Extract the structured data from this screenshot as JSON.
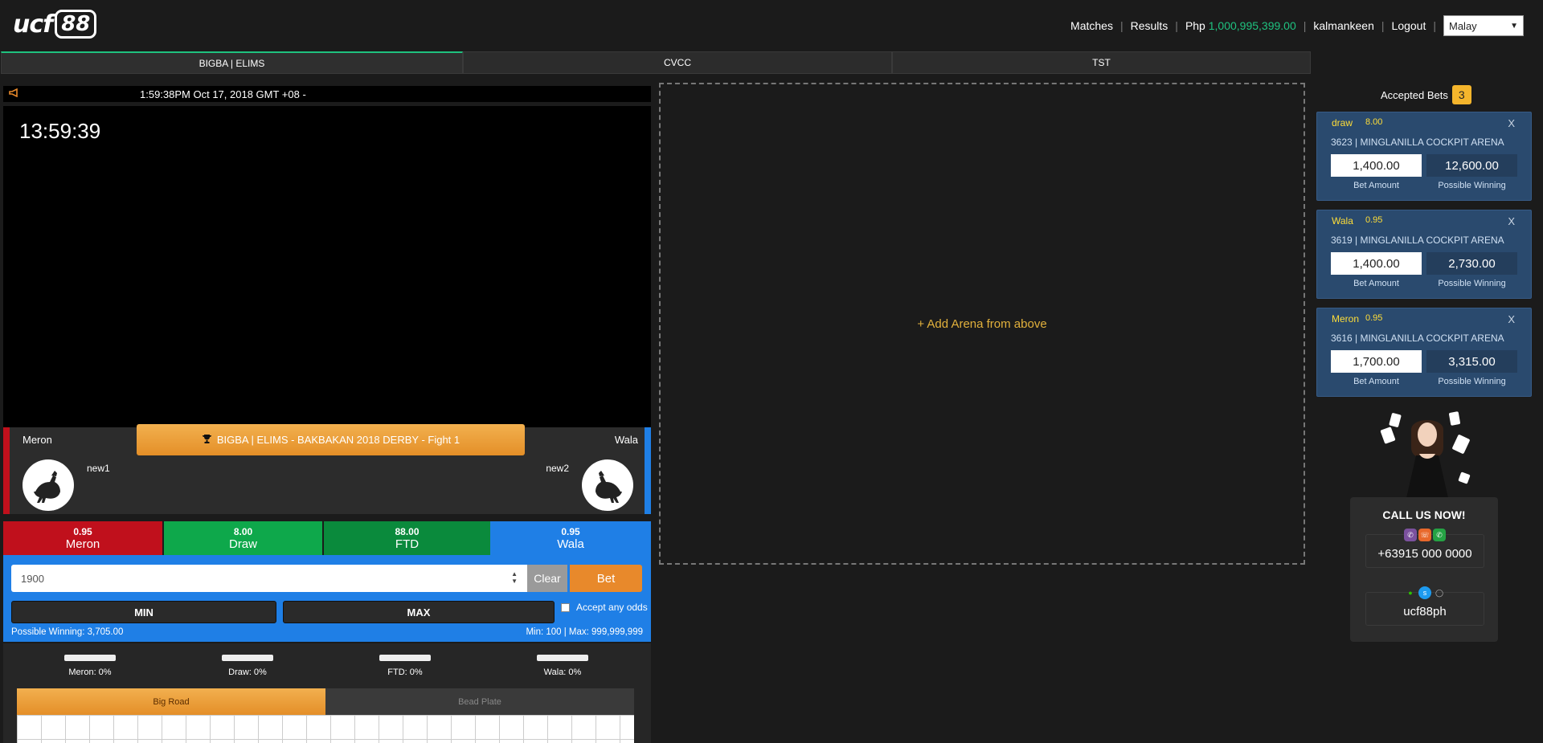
{
  "header": {
    "logo_text": "ucf",
    "logo_num": "88",
    "nav": {
      "matches": "Matches",
      "results": "Results",
      "currency": "Php",
      "balance": "1,000,995,399.00",
      "username": "kalmankeen",
      "logout": "Logout",
      "language": "Malay"
    }
  },
  "tabs": [
    {
      "label": "BIGBA | ELIMS",
      "active": true
    },
    {
      "label": "CVCC",
      "active": false
    },
    {
      "label": "TST",
      "active": false
    }
  ],
  "ticker": {
    "text": "1:59:38PM Oct 17, 2018 GMT +08 -"
  },
  "video": {
    "clock": "13:59:39"
  },
  "fight": {
    "title": "BIGBA | ELIMS - BAKBAKAN 2018 DERBY - Fight 1",
    "left_side": "Meron",
    "right_side": "Wala",
    "left_name": "new1",
    "right_name": "new2"
  },
  "odds": [
    {
      "odds": "0.95",
      "label": "Meron",
      "color": "#c0101c"
    },
    {
      "odds": "8.00",
      "label": "Draw",
      "color": "#0ea84b"
    },
    {
      "odds": "88.00",
      "label": "FTD",
      "color": "#0a8a3c"
    },
    {
      "odds": "0.95",
      "label": "Wala",
      "color": "#1f7fe6"
    }
  ],
  "bet": {
    "amount_value": "1900",
    "clear_label": "Clear",
    "bet_label": "Bet",
    "min_label": "MIN",
    "max_label": "MAX",
    "accept_any_odds": "Accept any odds",
    "possible_winning": "Possible Winning: 3,705.00",
    "limits": "Min: 100 | Max: 999,999,999"
  },
  "stats": [
    {
      "label": "Meron: 0%",
      "percent": 0
    },
    {
      "label": "Draw: 0%",
      "percent": 0
    },
    {
      "label": "FTD: 0%",
      "percent": 0
    },
    {
      "label": "Wala: 0%",
      "percent": 0
    }
  ],
  "road_tabs": {
    "big_road": "Big Road",
    "bead_plate": "Bead Plate"
  },
  "arena_placeholder": "+ Add Arena from above",
  "accepted_bets": {
    "title": "Accepted Bets",
    "count": "3",
    "items": [
      {
        "type": "draw",
        "odds": "8.00",
        "arena": "3623 | MINGLANILLA COCKPIT ARENA",
        "amount": "1,400.00",
        "winning": "12,600.00",
        "close": "X",
        "amount_label": "Bet Amount",
        "winning_label": "Possible Winning"
      },
      {
        "type": "Wala",
        "odds": "0.95",
        "arena": "3619 | MINGLANILLA COCKPIT ARENA",
        "amount": "1,400.00",
        "winning": "2,730.00",
        "close": "X",
        "amount_label": "Bet Amount",
        "winning_label": "Possible Winning"
      },
      {
        "type": "Meron",
        "odds": "0.95",
        "arena": "3616 | MINGLANILLA COCKPIT ARENA",
        "amount": "1,700.00",
        "winning": "3,315.00",
        "close": "X",
        "amount_label": "Bet Amount",
        "winning_label": "Possible Winning"
      }
    ]
  },
  "contact": {
    "title": "CALL US NOW!",
    "phone": "+63915 000 0000",
    "handle": "ucf88ph"
  }
}
